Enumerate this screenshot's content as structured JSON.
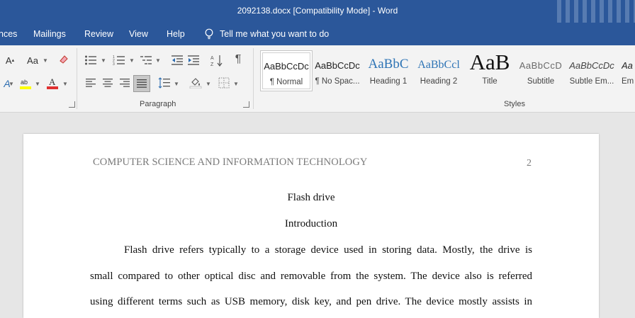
{
  "title_bar": {
    "title": "2092138.docx [Compatibility Mode]  -  Word"
  },
  "tabs": [
    "nces",
    "Mailings",
    "Review",
    "View",
    "Help"
  ],
  "tell_me": {
    "label": "Tell me what you want to do"
  },
  "groups": {
    "paragraph": "Paragraph",
    "styles": "Styles"
  },
  "font_controls": {
    "change_case": "Aa",
    "grow": "A"
  },
  "styles": [
    {
      "preview": "AaBbCcDc",
      "name": "¶ Normal"
    },
    {
      "preview": "AaBbCcDc",
      "name": "¶ No Spac..."
    },
    {
      "preview": "AaBbC",
      "name": "Heading 1"
    },
    {
      "preview": "AaBbCcl",
      "name": "Heading 2"
    },
    {
      "preview": "AaB",
      "name": "Title"
    },
    {
      "preview": "AaBbCcD",
      "name": "Subtitle"
    },
    {
      "preview": "AaBbCcDc",
      "name": "Subtle Em..."
    },
    {
      "preview": "Aa",
      "name": "Em"
    }
  ],
  "colors": {
    "accent": "#2b579a",
    "highlight": "#ffff00",
    "font_color": "#e03030"
  },
  "document": {
    "header": "COMPUTER SCIENCE AND INFORMATION TECHNOLOGY",
    "page_number": "2",
    "title": "Flash drive",
    "heading": "Introduction",
    "lines": [
      "Flash drive refers typically to a storage device used in storing data. Mostly, the drive is",
      "small compared to other optical disc and removable from the system. The device also is referred",
      "using different terms such as USB memory, disk key, and pen drive. The device mostly assists in"
    ]
  }
}
